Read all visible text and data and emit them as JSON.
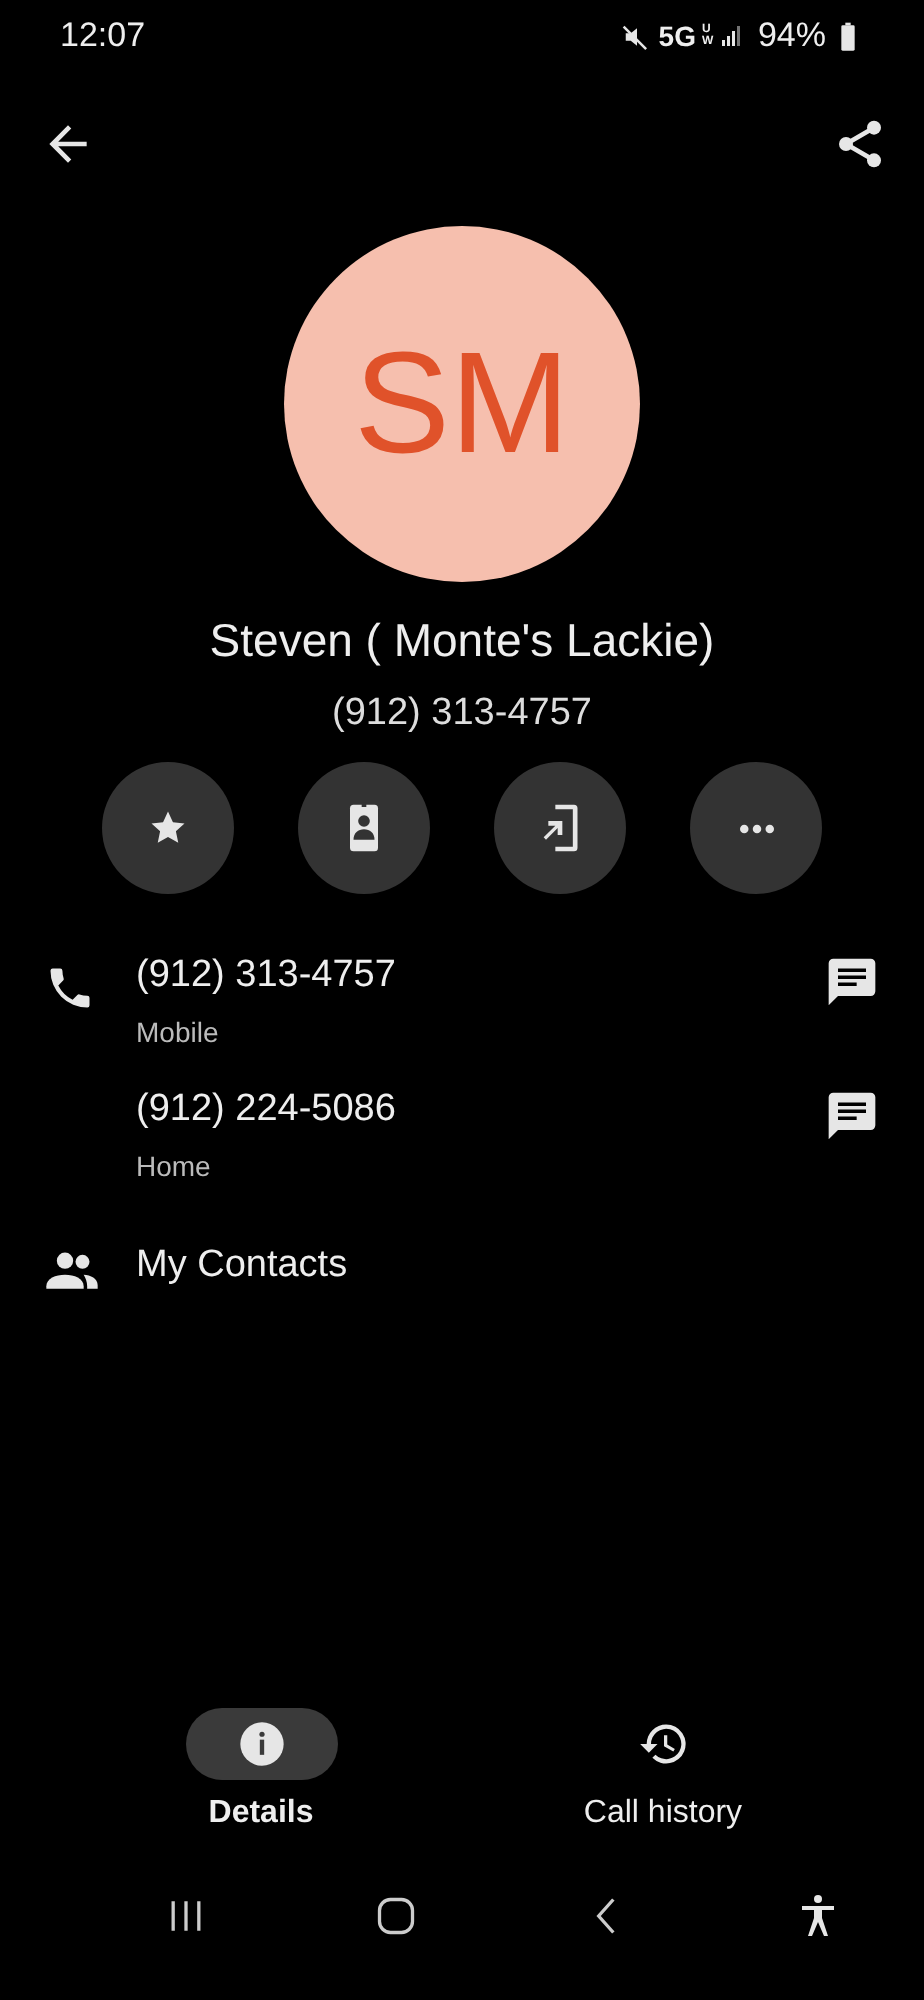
{
  "status_bar": {
    "time": "12:07",
    "network": "5G",
    "network_sub": "UW",
    "battery": "94%"
  },
  "contact": {
    "initials": "SM",
    "name": "Steven ( Monte's Lackie)",
    "phone": "(912) 313-4757"
  },
  "actions": [
    {
      "kind": "favorite",
      "selected": false
    },
    {
      "kind": "card"
    },
    {
      "kind": "share_phone"
    },
    {
      "kind": "more"
    }
  ],
  "numbers": [
    {
      "number": "(912) 313-4757",
      "label": "Mobile",
      "show_icon": true
    },
    {
      "number": "(912) 224-5086",
      "label": "Home",
      "show_icon": false
    }
  ],
  "groups": {
    "label": "My Contacts"
  },
  "tabs": [
    {
      "label": "Details",
      "kind": "info",
      "selected": true
    },
    {
      "label": "Call history",
      "kind": "history",
      "selected": false
    }
  ]
}
